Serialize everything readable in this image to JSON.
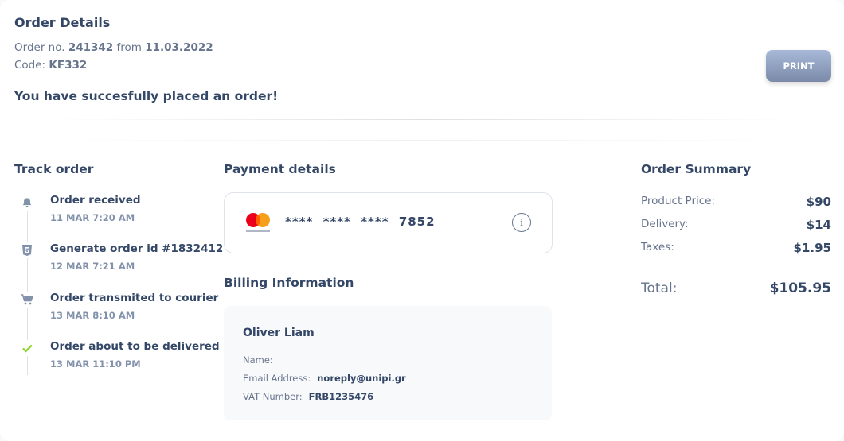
{
  "header": {
    "title": "Order Details",
    "order_prefix": "Order no.",
    "order_number": "241342",
    "from_word": "from",
    "order_date": "11.03.2022",
    "code_label": "Code:",
    "code_value": "KF332",
    "success_message": "You have succesfully placed an order!",
    "print_label": "PRINT"
  },
  "track": {
    "title": "Track order",
    "steps": [
      {
        "title": "Order received",
        "date": "11 MAR 7:20 AM",
        "icon": "bell-icon",
        "color": "#8392ab"
      },
      {
        "title": "Generate order id #1832412",
        "date": "12 MAR 7:21 AM",
        "icon": "html5-icon",
        "color": "#8392ab"
      },
      {
        "title": "Order transmited to courier",
        "date": "13 MAR 8:10 AM",
        "icon": "cart-icon",
        "color": "#8392ab"
      },
      {
        "title": "Order about to be delivered",
        "date": "13 MAR 11:10 PM",
        "icon": "check-icon",
        "color": "#82d616"
      }
    ]
  },
  "payment": {
    "title": "Payment details",
    "card_mask": "****  ****  ****",
    "card_last4": "7852",
    "info_glyph": "i",
    "brand_icon": "mastercard-icon"
  },
  "billing": {
    "title": "Billing Information",
    "name": "Oliver Liam",
    "name_label": "Name:",
    "email_label": "Email Address:",
    "email_value": "noreply@unipi.gr",
    "vat_label": "VAT Number:",
    "vat_value": "FRB1235476"
  },
  "summary": {
    "title": "Order Summary",
    "product_label": "Product Price:",
    "product_value": "$90",
    "delivery_label": "Delivery:",
    "delivery_value": "$14",
    "taxes_label": "Taxes:",
    "taxes_value": "$1.95",
    "total_label": "Total:",
    "total_value": "$105.95"
  }
}
